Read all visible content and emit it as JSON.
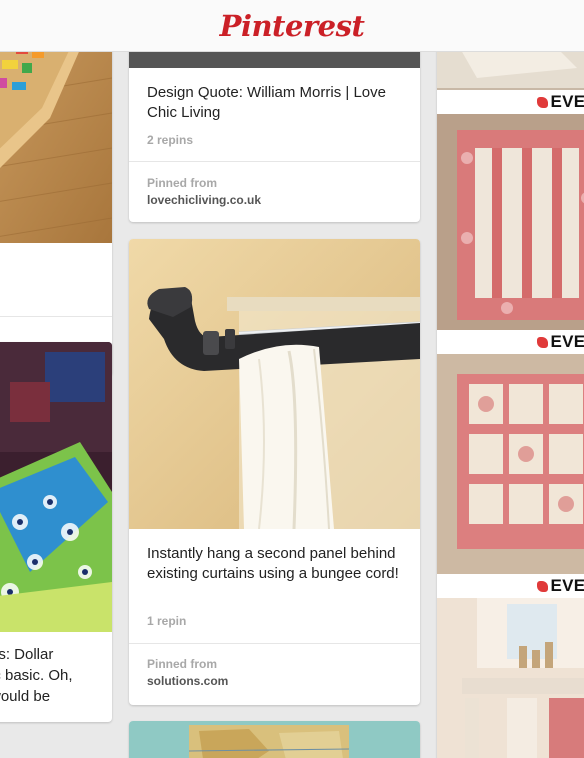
{
  "app": {
    "logo_text": "Pinterest"
  },
  "pins": {
    "left": {
      "snippet_lines": [
        "ns: Dollar",
        "ic basic. Oh,",
        "would be"
      ]
    },
    "center": [
      {
        "description": "Design Quote: William Morris | Love Chic Living",
        "repins": "2 repins",
        "pinned_from_label": "Pinned from",
        "source": "lovechicliving.co.uk"
      },
      {
        "description": "Instantly hang a second panel behind existing curtains using a bungee cord!",
        "repins": "1 repin",
        "pinned_from_label": "Pinned from",
        "source": "solutions.com"
      }
    ],
    "right": {
      "overlay_texts": [
        "EVER",
        "EVER",
        "EVER"
      ]
    }
  },
  "colors": {
    "brand": "#cb2027",
    "background": "#e9e9e9",
    "card": "#ffffff"
  }
}
